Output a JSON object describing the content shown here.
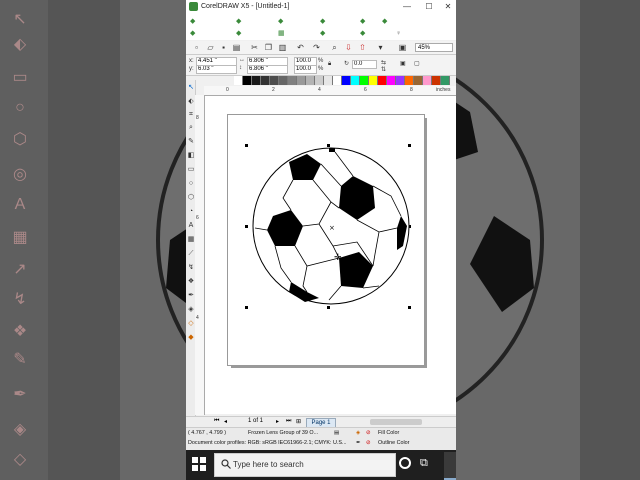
{
  "window": {
    "title": "CorelDRAW X5 - [Untitled-1]",
    "controls": {
      "minimize": "—",
      "maximize": "☐",
      "close": "✕"
    }
  },
  "standard_toolbar": {
    "zoom": "45%"
  },
  "property_bar": {
    "x": "4.451 \"",
    "y": "6.03 \"",
    "width": "6.806 \"",
    "height": "6.806 \"",
    "scale_w": "100.0",
    "scale_h": "100.0",
    "pct": "%",
    "rotation": "0.0",
    "x_label": "x:",
    "y_label": "y:"
  },
  "palette": {
    "colors": [
      "#ffffff",
      "#000000",
      "#1a1a1a",
      "#333333",
      "#4d4d4d",
      "#666666",
      "#808080",
      "#999999",
      "#b3b3b3",
      "#cccccc",
      "#e6e6e6",
      "#ffffff",
      "#0000ff",
      "#00ffff",
      "#00ff00",
      "#ffff00",
      "#ff0000",
      "#ff00ff",
      "#9933ff",
      "#ff6600",
      "#996633",
      "#ff99cc",
      "#cc3300",
      "#339966"
    ]
  },
  "ruler": {
    "h_ticks": [
      "0",
      "2",
      "4",
      "6",
      "8"
    ],
    "h_unit": "inches",
    "v_ticks": [
      "8",
      "6",
      "4"
    ]
  },
  "page_nav": {
    "page_count": "1 of 1",
    "page_tab": "Page 1"
  },
  "status": {
    "coords": "( 4.767 , 4.799 )",
    "object_info": "Frozen Lens Group of 39 O...",
    "fill_label": "Fill Color",
    "outline_label": "Outline Color",
    "color_profiles": "Document color profiles: RGB: sRGB IEC61966-2.1; CMYK: U.S..."
  },
  "taskbar": {
    "search_placeholder": "Type here to search"
  }
}
